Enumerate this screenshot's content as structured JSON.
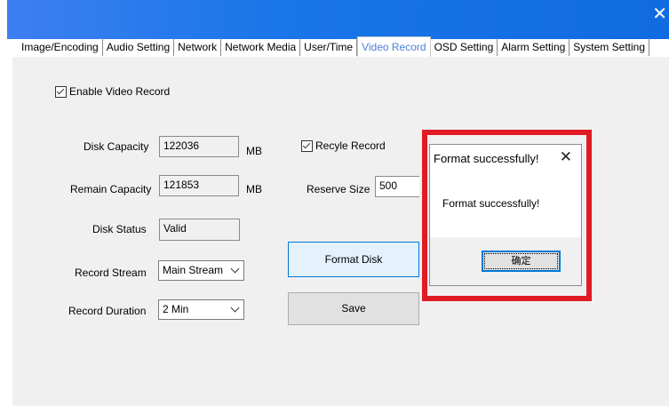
{
  "window": {
    "close_glyph": "✕"
  },
  "tabs": [
    {
      "label": "Image/Encoding"
    },
    {
      "label": "Audio Setting"
    },
    {
      "label": "Network"
    },
    {
      "label": "Network Media"
    },
    {
      "label": "User/Time"
    },
    {
      "label": "Video Record",
      "active": true
    },
    {
      "label": "OSD Setting"
    },
    {
      "label": "Alarm Setting"
    },
    {
      "label": "System Setting"
    }
  ],
  "form": {
    "enable_video_record": {
      "label": "Enable Video Record",
      "checked": true
    },
    "disk_capacity": {
      "label": "Disk Capacity",
      "value": "122036",
      "unit": "MB"
    },
    "remain_capacity": {
      "label": "Remain Capacity",
      "value": "121853",
      "unit": "MB"
    },
    "disk_status": {
      "label": "Disk Status",
      "value": "Valid"
    },
    "record_stream": {
      "label": "Record Stream",
      "value": "Main Stream"
    },
    "record_duration": {
      "label": "Record Duration",
      "value": "2 Min"
    },
    "recycle_record": {
      "label": "Recyle Record",
      "checked": true
    },
    "reserve_size": {
      "label": "Reserve Size",
      "value": "500"
    },
    "format_disk_label": "Format Disk",
    "save_label": "Save"
  },
  "dialog": {
    "title": "Format successfully!",
    "close_glyph": "✕",
    "message": "Format successfully!",
    "ok_label": "确定"
  },
  "colors": {
    "titlebar": "#1976e8",
    "active_tab": "#4e7fd8",
    "highlight": "#e01b24"
  }
}
